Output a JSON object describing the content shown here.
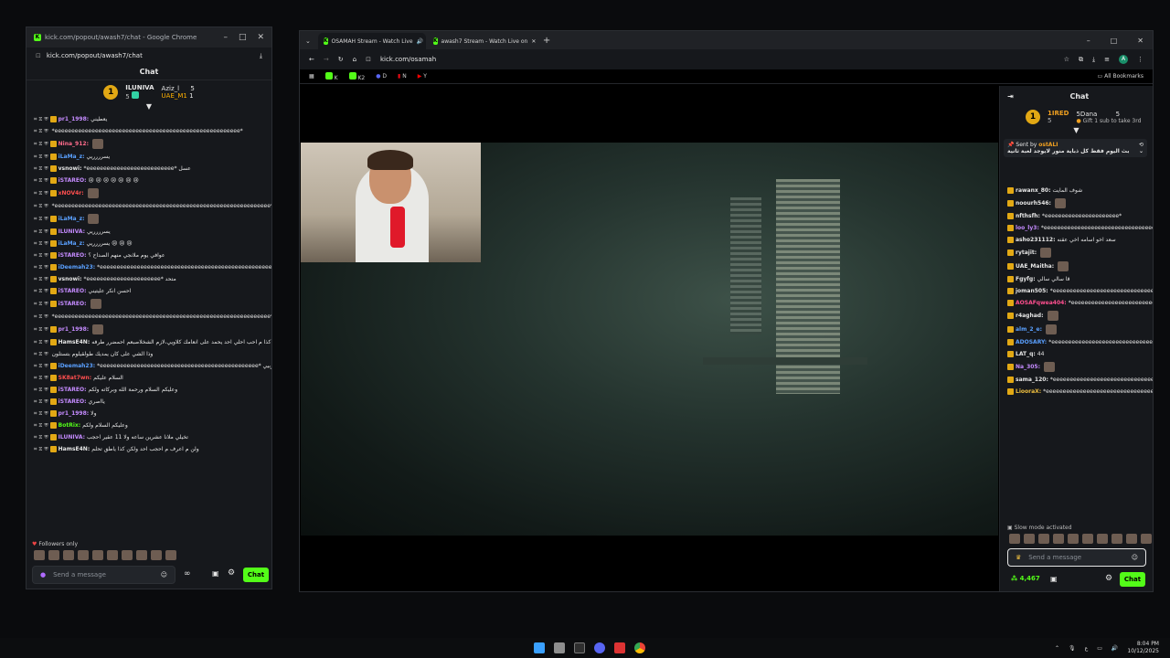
{
  "popout": {
    "window_title": "kick.com/popout/awash7/chat - Google Chrome",
    "url": "kick.com/popout/awash7/chat",
    "header": "Chat",
    "leader": {
      "rank": "1",
      "name1": "ILUNIVA",
      "count1": "5",
      "name2": "Aziz_l",
      "count2": "5",
      "name3": "UAE_M1",
      "count3": "1",
      "sub": "5"
    },
    "messages": [
      {
        "user": "pr1_1998:",
        "text": "يعطيني",
        "color": "#c58bff"
      },
      {
        "user": "",
        "text": "*eeeeeeeeeeeeeeeeeeeeeeeeeeeeeeeeeeeeeeeeeeeeeeeeeeeeeee*",
        "color": "#e6e6e6"
      },
      {
        "user": "Nina_912:",
        "text": "",
        "color": "#ff6b8b"
      },
      {
        "user": "iLaMa_z:",
        "text": "يسرررريي",
        "color": "#5aa0ff"
      },
      {
        "user": "vsnowi:",
        "text": "*eeeeeeeeeeeeeeeeeeeeeeeeee* عسل",
        "color": "#e6e6e6"
      },
      {
        "user": "iSTAREO:",
        "text": "😢 😢 😢 😢 😢 😢 😢",
        "color": "#c58bff"
      },
      {
        "user": "xNOV4r:",
        "text": "",
        "color": "#ff4f4f"
      },
      {
        "user": "",
        "text": "*eeeeeeeeeeeeeeeeeeeeeeeeeeeeeeeeeeeeeeeeeeeeeeeeeeeeeeeeeeeeeeee*",
        "color": "#e6e6e6"
      },
      {
        "user": "iLaMa_z:",
        "text": "",
        "color": "#5aa0ff"
      },
      {
        "user": "ILUNIVA:",
        "text": "يسرررريي",
        "color": "#c58bff"
      },
      {
        "user": "iLaMa_z:",
        "text": "يسرررريي 😢 😢 😢",
        "color": "#5aa0ff"
      },
      {
        "user": "iSTAREO:",
        "text": "عوافي يوم ملانجي منهم الصداح ؟",
        "color": "#c58bff"
      },
      {
        "user": "iDeemah23:",
        "text": "*eeeeeeeeeeeeeeeeeeeeeeeeeeeeeeeeeeeeeeeeeeeeeeeeeeeeeeeeee*",
        "color": "#5aa0ff"
      },
      {
        "user": "vsnowi:",
        "text": "*eeeeeeeeeeeeeeeeeeeeee* متحد",
        "color": "#e6e6e6"
      },
      {
        "user": "iSTAREO:",
        "text": "احسن انكر عليتيني",
        "color": "#c58bff"
      },
      {
        "user": "iSTAREO:",
        "text": "",
        "color": "#c58bff"
      },
      {
        "user": "",
        "text": "*eeeeeeeeeeeeeeeeeeeeeeeeeeeeeeeeeeeeeeeeeeeeeeeeeeeeeeeeeeeeeeee*",
        "color": "#e6e6e6"
      },
      {
        "user": "pr1_1998:",
        "text": "",
        "color": "#c58bff"
      },
      {
        "user": "HamsE4N:",
        "text": "عشان كذا م احب احلي احد يحمد على انعامك كلاويي،لازم الشخلاصبعم احمضرر طرفه",
        "color": "#e6e6e6"
      },
      {
        "user": "",
        "text": "وذا الشي على كان يمديك طولقيلوم بتستلون",
        "color": "#e6e6e6"
      },
      {
        "user": "iDeemah23:",
        "text": "*eeeeeeeeeeeeeeeeeeeeeeeeeeeeeeeeeeeeeeeeeeeeeee* احمدح باعممرربيي",
        "color": "#5aa0ff"
      },
      {
        "user": "SK8at7wn:",
        "text": "السلام عليكم",
        "color": "#ff4f4f"
      },
      {
        "user": "iSTAREO:",
        "text": "وعليكم السلام ورحمة الله وبركاته ولكم",
        "color": "#c58bff"
      },
      {
        "user": "iSTAREO:",
        "text": "يااصري",
        "color": "#c58bff"
      },
      {
        "user": "pr1_1998:",
        "text": "ولا",
        "color": "#c58bff"
      },
      {
        "user": "BotRix:",
        "text": "وعليكم السلام ولكم",
        "color": "#53fc18"
      },
      {
        "user": "ILUNIVA:",
        "text": "تخيلي ملانا عشرين ساعه ولا 11 عقير احجب",
        "color": "#c58bff"
      },
      {
        "user": "HamsE4N:",
        "text": "ولن م اعرف م احجب احد ولكن كذا ياطق تحلم",
        "color": "#e6e6e6"
      }
    ],
    "followers_only": "Followers only",
    "input_placeholder": "Send a message",
    "chat_button": "Chat"
  },
  "browser": {
    "tabs": [
      {
        "label": "OSAMAH Stream - Watch Live",
        "active": true
      },
      {
        "label": "awash7 Stream - Watch Live on",
        "active": false
      }
    ],
    "url": "kick.com/osamah",
    "bookmarks": [
      "K",
      "K2",
      "D",
      "N",
      "Y"
    ],
    "all_bookmarks": "All Bookmarks"
  },
  "side_chat": {
    "header": "Chat",
    "leader": {
      "rank": "1",
      "name": "1IRED",
      "count1": "5",
      "name2": "5Dana",
      "count2": "5",
      "gift": "Gift 1 sub to take 3rd"
    },
    "pinned": {
      "label": "Sent by",
      "user": "ostALI",
      "text": "بث اليوم فقط كل ذباية منور لايوجد لعبة ثانية"
    },
    "messages": [
      {
        "user": "rawanx_80:",
        "text": "شوف المايت",
        "color": "#e6e6e6"
      },
      {
        "user": "noourh546:",
        "text": "",
        "color": "#e6e6e6"
      },
      {
        "user": "nfthsfh:",
        "text": "*eeeeeeeeeeeeeeeeeeeeee*",
        "color": "#e6e6e6"
      },
      {
        "user": "loo_ly3:",
        "text": "*eeeeeeeeeeeeeeeeeeeeeeeeeeeeeeeeeeeeeeeeeeeeeeeeeeeeeeeeeeeeeeeeeeee*",
        "color": "#c58bff"
      },
      {
        "user": "asho231112:",
        "text": "سعد اخو اسامه اخي عقنه",
        "color": "#e6e6e6"
      },
      {
        "user": "rytajit:",
        "text": "",
        "color": "#e6e6e6"
      },
      {
        "user": "UAE_Maitha:",
        "text": "",
        "color": "#e6e6e6"
      },
      {
        "user": "Fgyfg:",
        "text": "قا سالي سالي",
        "color": "#e6e6e6"
      },
      {
        "user": "joman505:",
        "text": "*eeeeeeeeeeeeeeeeeeeeeeeeeeeeeeeeeee*",
        "color": "#e6e6e6"
      },
      {
        "user": "AOSAFqwea404:",
        "text": "*eeeeeeeeeeeeeeeeeeeeeeeeeeeeeeeeeeeeeeeeeeeeeeeeeeeeeeeeeeeeeeeee*",
        "color": "#ff4f8f"
      },
      {
        "user": "r4aghad:",
        "text": "",
        "color": "#e6e6e6"
      },
      {
        "user": "alm_2_e:",
        "text": "",
        "color": "#5aa0ff"
      },
      {
        "user": "ADOSARY:",
        "text": "*eeeeeeeeeeeeeeeeeeeeeeeeeeeeeeeeeeeeeeeeeeeeeeeeeeeeeeeeeee*",
        "color": "#5aa0ff"
      },
      {
        "user": "LAT_q:",
        "text": "44",
        "color": "#e6e6e6"
      },
      {
        "user": "Na_305:",
        "text": "",
        "color": "#c58bff"
      },
      {
        "user": "sama_120:",
        "text": "*eeeeeeeeeeeeeeeeeeeeeeeeeeeeeeeeeeeeee*",
        "color": "#e6e6e6"
      },
      {
        "user": "LiooraX:",
        "text": "*eeeeeeeeeeeeeeeeeeeeeeeeeeeeeeeeeeeeeeeeeeeeeeeeeeeeee*",
        "color": "#f0c040"
      }
    ],
    "slow_mode": "Slow mode activated",
    "input_placeholder": "Send a message",
    "points": "4,467",
    "chat_button": "Chat"
  },
  "taskbar": {
    "time": "8:04 PM",
    "date": "10/12/2025"
  }
}
